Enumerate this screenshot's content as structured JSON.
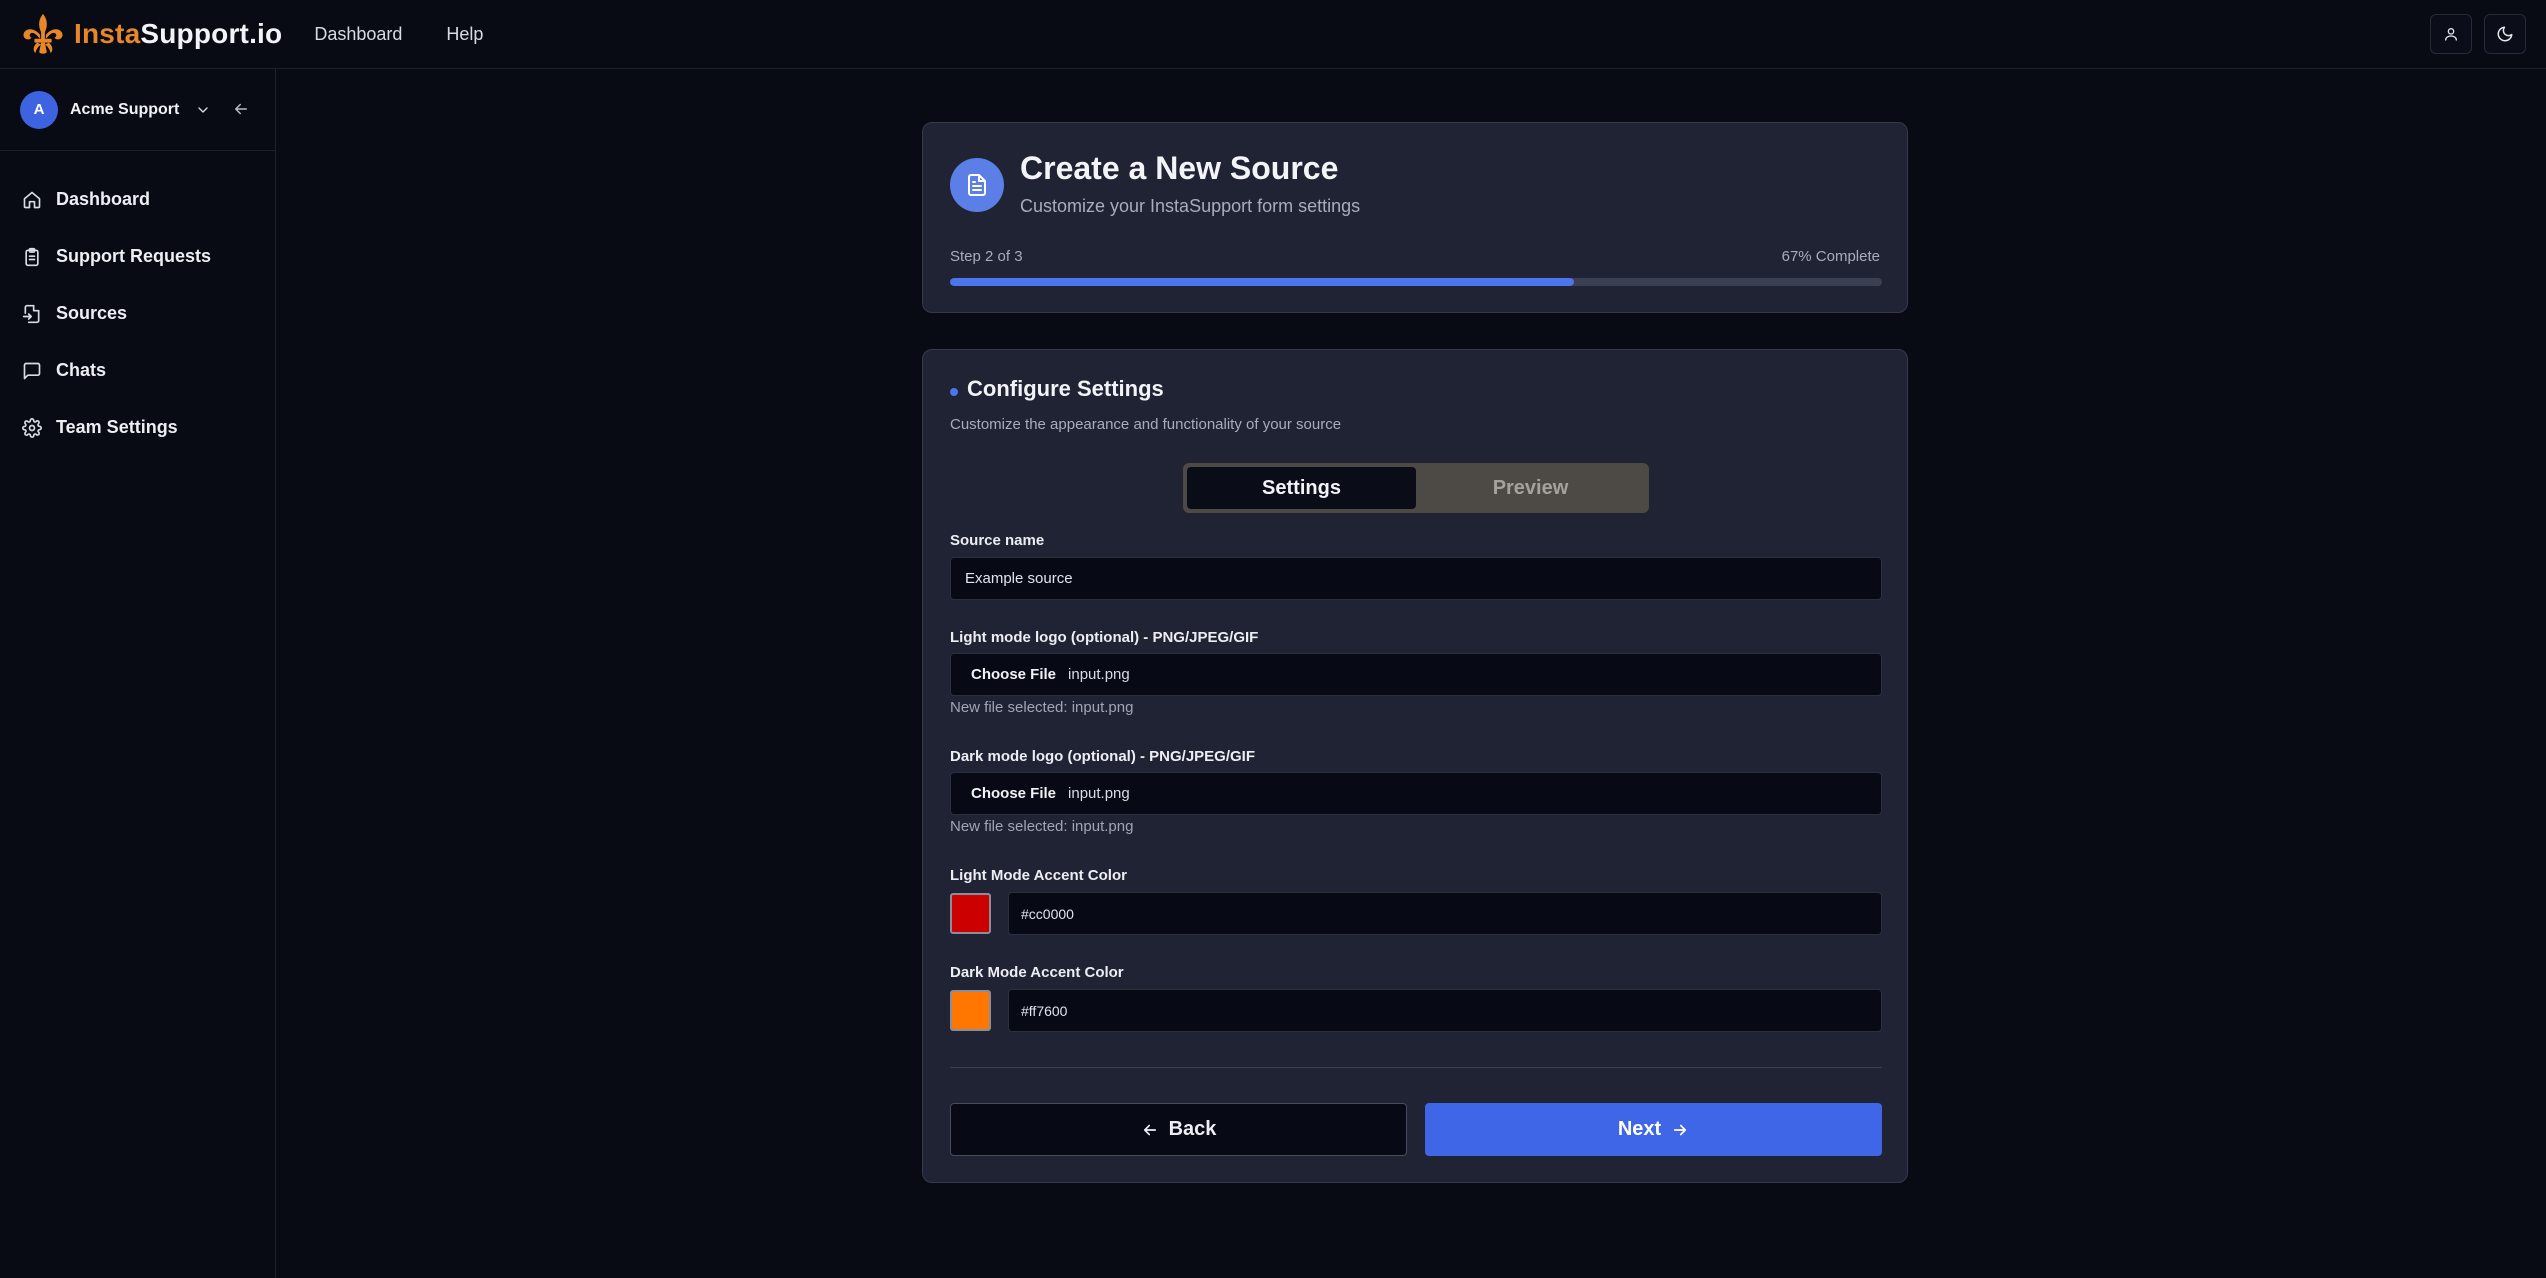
{
  "header": {
    "brand_part1": "Insta",
    "brand_part2": "Support.io",
    "nav": [
      "Dashboard",
      "Help"
    ],
    "brand_color": "#e8862a"
  },
  "sidebar": {
    "org": {
      "initial": "A",
      "name": "Acme Support"
    },
    "items": [
      {
        "label": "Dashboard",
        "icon": "home-icon"
      },
      {
        "label": "Support Requests",
        "icon": "clipboard-icon"
      },
      {
        "label": "Sources",
        "icon": "file-import-icon"
      },
      {
        "label": "Chats",
        "icon": "chat-bubble-icon"
      },
      {
        "label": "Team Settings",
        "icon": "gear-icon"
      }
    ]
  },
  "wizard": {
    "title": "Create a New Source",
    "subtitle": "Customize your InstaSupport form settings",
    "step_text": "Step 2 of 3",
    "complete_text": "67% Complete",
    "progress": 0.67
  },
  "form": {
    "section_title": "Configure Settings",
    "section_subtitle": "Customize the appearance and functionality of your source",
    "tabs": [
      "Settings",
      "Preview"
    ],
    "active_tab": "Settings",
    "source_name_label": "Source name",
    "source_name_value": "Example source",
    "light_logo_label": "Light mode logo (optional) - PNG/JPEG/GIF",
    "light_logo_button": "Choose File",
    "light_logo_file": "input.png",
    "light_logo_hint": "New file selected: input.png",
    "dark_logo_label": "Dark mode logo (optional) - PNG/JPEG/GIF",
    "dark_logo_button": "Choose File",
    "dark_logo_file": "input.png",
    "dark_logo_hint": "New file selected: input.png",
    "light_accent_label": "Light Mode Accent Color",
    "light_accent_value": "#cc0000",
    "dark_accent_label": "Dark Mode Accent Color",
    "dark_accent_value": "#ff7600",
    "back_label": "Back",
    "next_label": "Next"
  },
  "colors": {
    "primary": "#3f66e6",
    "background": "#080a14",
    "card": "#1f2333"
  }
}
